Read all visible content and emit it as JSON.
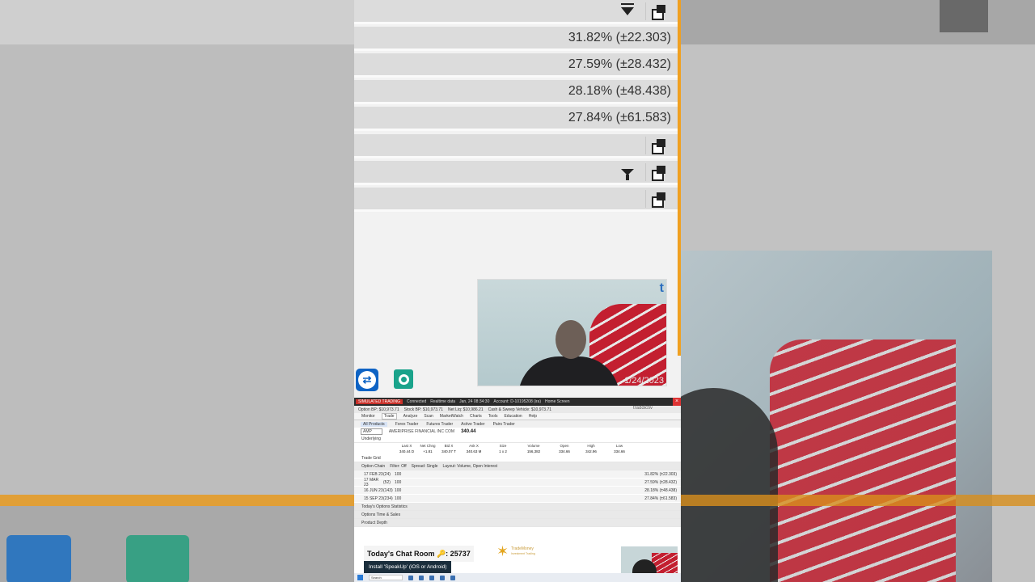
{
  "zoomed": {
    "rows": [
      {
        "value": "",
        "icons": [
          "filter-down-icon",
          "popout-icon"
        ]
      },
      {
        "value": "31.82% (±22.303)"
      },
      {
        "value": "27.59% (±28.432)"
      },
      {
        "value": "28.18% (±48.438)"
      },
      {
        "value": "27.84% (±61.583)"
      },
      {
        "value": "",
        "icons": [
          "popout-icon"
        ]
      },
      {
        "value": "",
        "icons": [
          "funnel-icon",
          "popout-icon"
        ]
      },
      {
        "value": "",
        "icons": [
          "popout-icon"
        ]
      }
    ]
  },
  "webcam": {
    "date": "1/24/2023"
  },
  "tos": {
    "titlebar": {
      "badge": "SIMULATED TRADING",
      "connected": "Connected",
      "realtime": "Realtime data",
      "datetime": "Jan, 24 08:34:30",
      "account": "Account: D-10195208 (ira)",
      "home": "Home Screen"
    },
    "account_bar": [
      "Option BP: $10,973.71",
      "Stock BP: $10,973.71",
      "Net Liq: $10,986.21",
      "Cash & Sweep Vehicle: $10,973.71"
    ],
    "main_tabs": [
      "Monitor",
      "Trade",
      "Analyze",
      "Scan",
      "MarketWatch",
      "Charts",
      "Tools",
      "Education",
      "Help"
    ],
    "selected_main_tab": "Trade",
    "sub_tabs": [
      "All Products",
      "Forex Trader",
      "Futures Trader",
      "Active Trader",
      "Pairs Trader"
    ],
    "symbol": "AMP",
    "company": "AMERIPRISE FINANCIAL INC COM",
    "price": "340.44",
    "underlying_label": "Underlying",
    "underlying_headers": [
      "Last X",
      "Net Chng",
      "Bid X",
      "Ask X",
      "Size",
      "Volume",
      "Open",
      "High",
      "Low"
    ],
    "underlying_values": [
      "340.44 D",
      "+1.81",
      "340.07 T",
      "340.63 M",
      "1 x 2",
      "156,382",
      "334.66",
      "342.96",
      "334.66"
    ],
    "trade_grid": "Trade Grid",
    "option_chain": "Option Chain",
    "filter": "Filter: Off",
    "spread": "Spread: Single",
    "layout": "Layout: Volume, Open Interest",
    "expirations": [
      {
        "date": "17 FEB 23",
        "days": "(24)",
        "mult": "100",
        "iv": "31.82% (±22.303)"
      },
      {
        "date": "17 MAR 23",
        "days": "(52)",
        "mult": "100",
        "iv": "27.59% (±28.432)"
      },
      {
        "date": "16 JUN 23",
        "days": "(143)",
        "mult": "100",
        "iv": "28.18% (±48.438)"
      },
      {
        "date": "15 SEP 23",
        "days": "(234)",
        "mult": "100",
        "iv": "27.84% (±61.583)"
      }
    ],
    "sections": [
      "Today's Options Statistics",
      "Options Time & Sales",
      "Product Depth"
    ],
    "brand": "traddictiv"
  },
  "overlay": {
    "chat_room": "Today's Chat Room 🔑: 25737",
    "install": "Install 'SpeakUp' (iOS or Android)",
    "logo_title": "TradeMoney",
    "logo_sub": "Investment Trading"
  },
  "taskbar": {
    "search": "Search"
  },
  "colors": {
    "accent_orange": "#f0a020",
    "sim_red": "#c9312a",
    "install_bg": "#1b2e3c"
  }
}
